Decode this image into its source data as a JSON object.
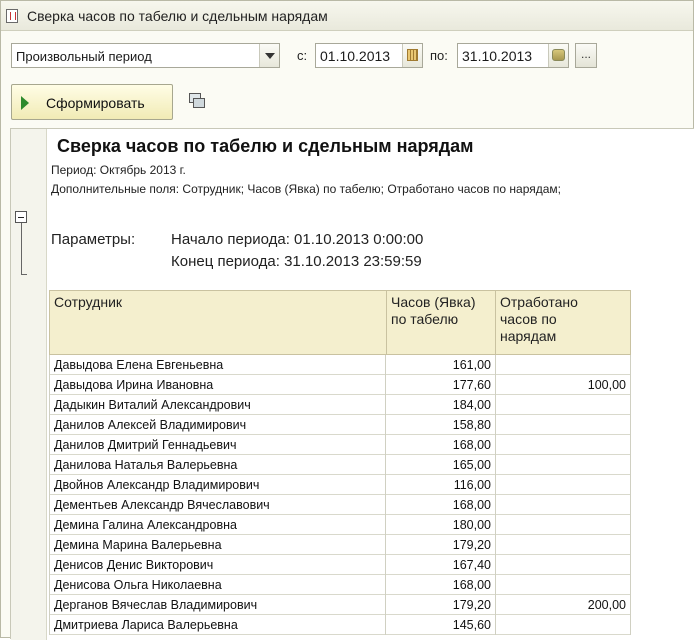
{
  "window": {
    "title": "Сверка часов по табелю и сдельным нарядам"
  },
  "filters": {
    "period_type": "Произвольный период",
    "from_label": "с:",
    "from_date": "01.10.2013",
    "to_label": "по:",
    "to_date": "31.10.2013",
    "more_label": "..."
  },
  "toolbar": {
    "generate_label": "Сформировать"
  },
  "report": {
    "title": "Сверка часов по табелю и сдельным нарядам",
    "period_line": "Период: Октябрь 2013 г.",
    "extra_fields_line": "Дополнительные поля: Сотрудник; Часов (Явка) по табелю; Отработано часов по нарядам;",
    "params_label": "Параметры:",
    "period_start": "Начало периода: 01.10.2013 0:00:00",
    "period_end": "Конец периода: 31.10.2013 23:59:59",
    "columns": [
      "Сотрудник",
      "Часов (Явка) по табелю",
      "Отработано часов по нарядам"
    ],
    "rows": [
      {
        "name": "Давыдова Елена Евгеньевна",
        "hours_timesheet": "161,00",
        "hours_orders": ""
      },
      {
        "name": "Давыдова Ирина Ивановна",
        "hours_timesheet": "177,60",
        "hours_orders": "100,00"
      },
      {
        "name": "Дадыкин Виталий Александрович",
        "hours_timesheet": "184,00",
        "hours_orders": ""
      },
      {
        "name": "Данилов Алексей Владимирович",
        "hours_timesheet": "158,80",
        "hours_orders": ""
      },
      {
        "name": "Данилов Дмитрий Геннадьевич",
        "hours_timesheet": "168,00",
        "hours_orders": ""
      },
      {
        "name": "Данилова Наталья Валерьевна",
        "hours_timesheet": "165,00",
        "hours_orders": ""
      },
      {
        "name": "Двойнов Александр Владимирович",
        "hours_timesheet": "116,00",
        "hours_orders": ""
      },
      {
        "name": "Дементьев Александр Вячеславович",
        "hours_timesheet": "168,00",
        "hours_orders": ""
      },
      {
        "name": "Демина Галина Александровна",
        "hours_timesheet": "180,00",
        "hours_orders": ""
      },
      {
        "name": "Демина Марина Валерьевна",
        "hours_timesheet": "179,20",
        "hours_orders": ""
      },
      {
        "name": "Денисов Денис Викторович",
        "hours_timesheet": "167,40",
        "hours_orders": ""
      },
      {
        "name": "Денисова Ольга Николаевна",
        "hours_timesheet": "168,00",
        "hours_orders": ""
      },
      {
        "name": "Дерганов Вячеслав Владимирович",
        "hours_timesheet": "179,20",
        "hours_orders": "200,00"
      },
      {
        "name": "Дмитриева Лариса Валерьевна",
        "hours_timesheet": "145,60",
        "hours_orders": ""
      }
    ]
  }
}
